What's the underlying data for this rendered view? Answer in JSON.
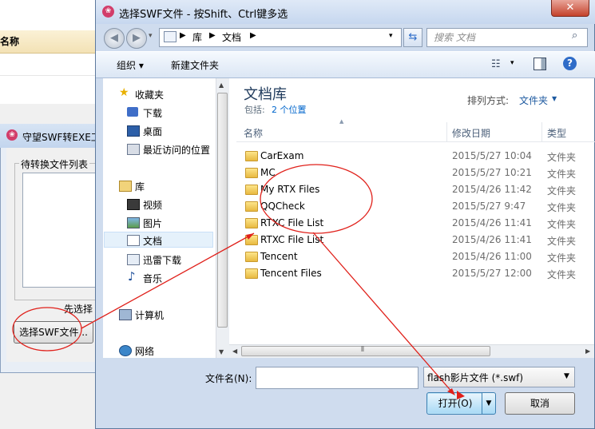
{
  "background": {
    "header_label": "名称",
    "app_title": "守望SWF转EXE工",
    "list_label": "待转换文件列表",
    "hint": "先选择",
    "select_button": "选择SWF文件..."
  },
  "dialog": {
    "title": "选择SWF文件 - 按Shift、Ctrl键多选",
    "close_glyph": "✕",
    "breadcrumb": [
      "库",
      "文档"
    ],
    "search_placeholder": "搜索 文档",
    "toolbar": {
      "organize": "组织 ▾",
      "new_folder": "新建文件夹"
    },
    "nav": {
      "favorites": "收藏夹",
      "downloads": "下载",
      "desktop": "桌面",
      "recent": "最近访问的位置",
      "libraries": "库",
      "videos": "视频",
      "pictures": "图片",
      "documents": "文档",
      "xunlei": "迅雷下载",
      "music": "音乐",
      "computer": "计算机",
      "network": "网络"
    },
    "library": {
      "title": "文档库",
      "includes": "包括:",
      "locations": "2 个位置",
      "arrange_label": "排列方式:",
      "arrange_value": "文件夹"
    },
    "columns": {
      "name": "名称",
      "date": "修改日期",
      "type": "类型"
    },
    "files": [
      {
        "name": "CarExam",
        "date": "2015/5/27 10:04",
        "type": "文件夹"
      },
      {
        "name": "MC",
        "date": "2015/5/27 10:21",
        "type": "文件夹"
      },
      {
        "name": "My RTX Files",
        "date": "2015/4/26 11:42",
        "type": "文件夹"
      },
      {
        "name": "QQCheck",
        "date": "2015/5/27 9:47",
        "type": "文件夹"
      },
      {
        "name": "RTXC File List",
        "date": "2015/4/26 11:41",
        "type": "文件夹"
      },
      {
        "name": "RTXC File List",
        "date": "2015/4/26 11:41",
        "type": "文件夹"
      },
      {
        "name": "Tencent",
        "date": "2015/4/26 11:00",
        "type": "文件夹"
      },
      {
        "name": "Tencent Files",
        "date": "2015/5/27 12:00",
        "type": "文件夹"
      }
    ],
    "filename_label": "文件名(N):",
    "filename_value": "",
    "filter": "flash影片文件 (*.swf)",
    "open_button": "打开(O)",
    "cancel_button": "取消"
  },
  "annotation_color": "#e0201a"
}
